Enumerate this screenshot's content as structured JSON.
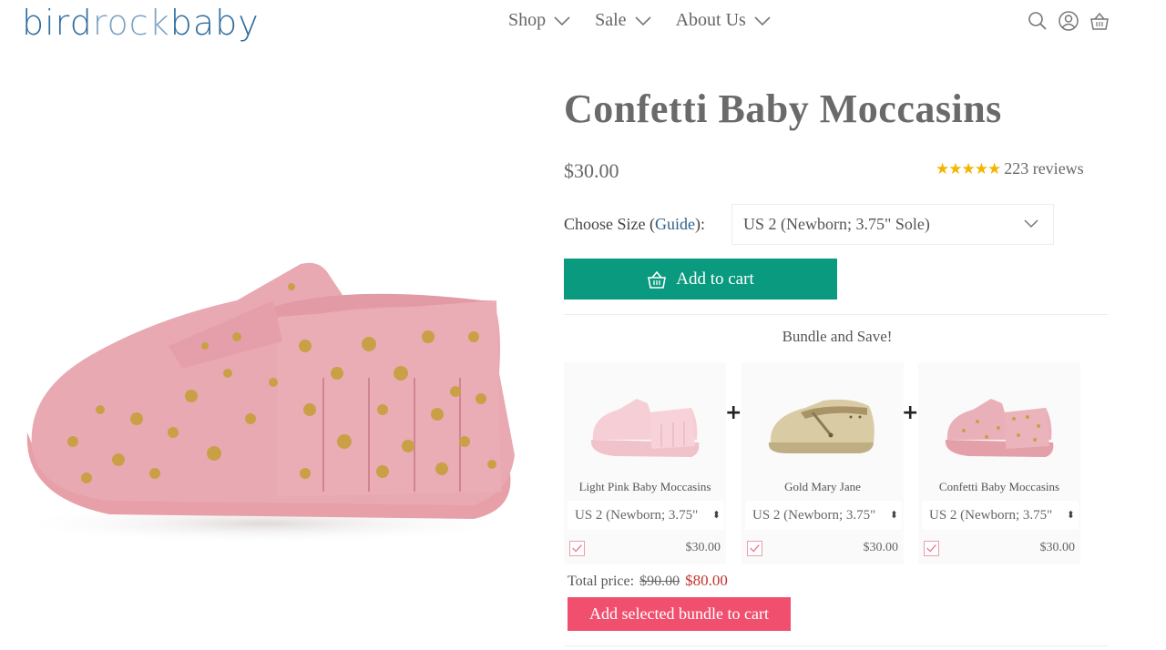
{
  "header": {
    "logo_part1": "bird",
    "logo_part2": "rock",
    "logo_part3": "baby",
    "nav": [
      {
        "label": "Shop"
      },
      {
        "label": "Sale"
      },
      {
        "label": "About Us"
      }
    ],
    "icons": [
      "search-icon",
      "account-icon",
      "cart-icon"
    ]
  },
  "product": {
    "title": "Confetti Baby Moccasins",
    "price": "$30.00",
    "stars": "★★★★★",
    "reviews": "223 reviews",
    "size_label_prefix": "Choose Size (",
    "size_guide": "Guide",
    "size_label_suffix": "):",
    "selected_size": "US 2 (Newborn; 3.75\" Sole)",
    "add_to_cart": "Add to cart"
  },
  "bundle": {
    "heading": "Bundle and Save!",
    "items": [
      {
        "name": "Light Pink Baby Moccasins",
        "variant": "US 2 (Newborn; 3.75\"",
        "price": "$30.00",
        "checked": true
      },
      {
        "name": "Gold Mary Jane",
        "variant": "US 2 (Newborn; 3.75\"",
        "price": "$30.00",
        "checked": true
      },
      {
        "name": "Confetti Baby Moccasins",
        "variant": "US 2 (Newborn; 3.75\"",
        "price": "$30.00",
        "checked": true
      }
    ],
    "plus": "+",
    "total_label": "Total price:",
    "total_old": "$90.00",
    "total_new": "$80.00",
    "add_bundle": "Add selected bundle to cart"
  },
  "colors": {
    "teal": "#0a9a7f",
    "pink_button": "#f0506e",
    "logo_blue": "#2f6d9e",
    "star": "#f4b400",
    "sale_red": "#c0312f"
  }
}
